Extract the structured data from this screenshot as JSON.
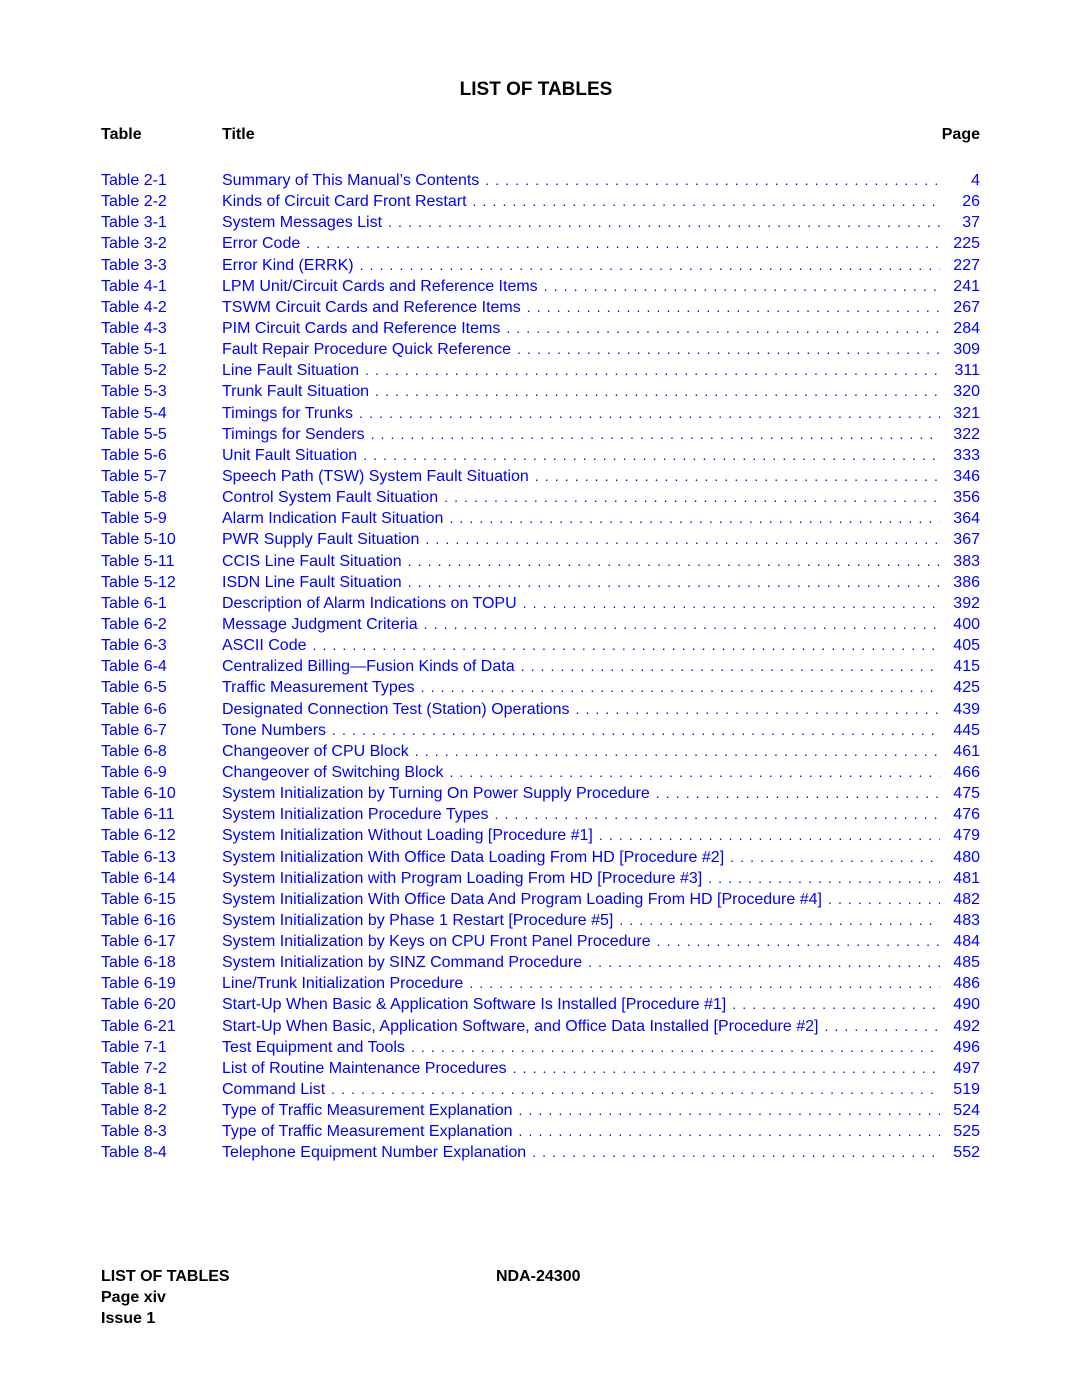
{
  "document": {
    "title": "LIST OF TABLES",
    "columns": {
      "table": "Table",
      "title": "Title",
      "page": "Page"
    },
    "link_color": "#0000ff",
    "entries": [
      {
        "table": "Table 2-1",
        "title": "Summary of This Manual’s Contents",
        "page": "4"
      },
      {
        "table": "Table 2-2",
        "title": "Kinds of Circuit Card Front Restart",
        "page": "26"
      },
      {
        "table": "Table 3-1",
        "title": "System Messages List",
        "page": "37"
      },
      {
        "table": "Table 3-2",
        "title": "Error Code",
        "page": "225"
      },
      {
        "table": "Table 3-3",
        "title": "Error Kind (ERRK)",
        "page": "227"
      },
      {
        "table": "Table 4-1",
        "title": "LPM Unit/Circuit Cards and Reference Items",
        "page": "241"
      },
      {
        "table": "Table 4-2",
        "title": "TSWM Circuit Cards and Reference Items",
        "page": "267"
      },
      {
        "table": "Table 4-3",
        "title": "PIM Circuit Cards and Reference Items",
        "page": "284"
      },
      {
        "table": "Table 5-1",
        "title": "Fault Repair Procedure Quick Reference",
        "page": "309"
      },
      {
        "table": "Table 5-2",
        "title": "Line Fault Situation",
        "page": "311"
      },
      {
        "table": "Table 5-3",
        "title": "Trunk Fault Situation",
        "page": "320"
      },
      {
        "table": "Table 5-4",
        "title": "Timings for Trunks",
        "page": "321"
      },
      {
        "table": "Table 5-5",
        "title": "Timings for Senders",
        "page": "322"
      },
      {
        "table": "Table 5-6",
        "title": "Unit Fault Situation",
        "page": "333"
      },
      {
        "table": "Table 5-7",
        "title": "Speech Path (TSW) System Fault Situation",
        "page": "346"
      },
      {
        "table": "Table 5-8",
        "title": "Control System Fault Situation",
        "page": "356"
      },
      {
        "table": "Table 5-9",
        "title": "Alarm Indication Fault Situation",
        "page": "364"
      },
      {
        "table": "Table 5-10",
        "title": "PWR Supply Fault Situation",
        "page": "367"
      },
      {
        "table": "Table 5-11",
        "title": "CCIS Line Fault Situation",
        "page": "383"
      },
      {
        "table": "Table 5-12",
        "title": "ISDN Line Fault Situation",
        "page": "386"
      },
      {
        "table": "Table 6-1",
        "title": "Description of Alarm Indications on TOPU",
        "page": "392"
      },
      {
        "table": "Table 6-2",
        "title": "Message Judgment Criteria",
        "page": "400"
      },
      {
        "table": "Table 6-3",
        "title": "ASCII Code",
        "page": "405"
      },
      {
        "table": "Table 6-4",
        "title": "Centralized Billing—Fusion Kinds of Data",
        "page": "415"
      },
      {
        "table": "Table 6-5",
        "title": "Traffic Measurement Types",
        "page": "425"
      },
      {
        "table": "Table 6-6",
        "title": "Designated Connection Test (Station) Operations",
        "page": "439"
      },
      {
        "table": "Table 6-7",
        "title": "Tone Numbers",
        "page": "445"
      },
      {
        "table": "Table 6-8",
        "title": "Changeover of CPU Block",
        "page": "461"
      },
      {
        "table": "Table 6-9",
        "title": "Changeover of Switching Block",
        "page": "466"
      },
      {
        "table": "Table 6-10",
        "title": "System Initialization by Turning On Power Supply Procedure",
        "page": "475"
      },
      {
        "table": "Table 6-11",
        "title": "System Initialization Procedure Types",
        "page": "476"
      },
      {
        "table": "Table 6-12",
        "title": "System Initialization Without Loading [Procedure #1]",
        "page": "479"
      },
      {
        "table": "Table 6-13",
        "title": "System Initialization With Office Data Loading From HD [Procedure #2]",
        "page": "480"
      },
      {
        "table": "Table 6-14",
        "title": "System Initialization with Program Loading From HD [Procedure #3]",
        "page": "481"
      },
      {
        "table": "Table 6-15",
        "title": "System Initialization With Office Data And Program Loading From HD [Procedure #4]",
        "page": "482"
      },
      {
        "table": "Table 6-16",
        "title": "System Initialization by Phase 1 Restart [Procedure #5]",
        "page": "483"
      },
      {
        "table": "Table 6-17",
        "title": "System Initialization by Keys on CPU Front Panel Procedure",
        "page": "484"
      },
      {
        "table": "Table 6-18",
        "title": "System Initialization by SINZ Command Procedure",
        "page": "485"
      },
      {
        "table": "Table 6-19",
        "title": "Line/Trunk Initialization Procedure",
        "page": "486"
      },
      {
        "table": "Table 6-20",
        "title": "Start-Up When Basic & Application Software Is Installed [Procedure #1]",
        "page": "490"
      },
      {
        "table": "Table 6-21",
        "title": "Start-Up When Basic, Application Software, and Office Data Installed [Procedure #2]",
        "page": "492"
      },
      {
        "table": "Table 7-1",
        "title": "Test Equipment and Tools",
        "page": "496"
      },
      {
        "table": "Table 7-2",
        "title": "List of Routine Maintenance Procedures",
        "page": "497"
      },
      {
        "table": "Table 8-1",
        "title": "Command List",
        "page": "519"
      },
      {
        "table": "Table 8-2",
        "title": "Type of Traffic Measurement Explanation",
        "page": "524"
      },
      {
        "table": "Table 8-3",
        "title": "Type of Traffic Measurement Explanation",
        "page": "525"
      },
      {
        "table": "Table 8-4",
        "title": "Telephone Equipment Number Explanation",
        "page": "552"
      }
    ]
  },
  "footer": {
    "section": "LIST OF TABLES",
    "page": "Page xiv",
    "issue": "Issue 1",
    "doc_number": "NDA-24300"
  }
}
